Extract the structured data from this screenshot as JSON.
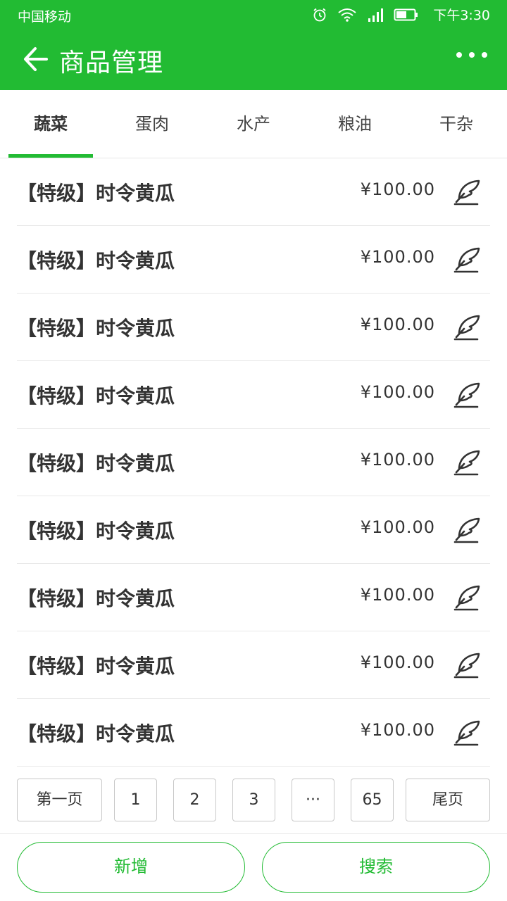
{
  "status_bar": {
    "carrier": "中国移动",
    "time": "下午3:30",
    "icons": [
      "alarm-icon",
      "wifi-icon",
      "signal-icon",
      "battery-icon"
    ]
  },
  "app_bar": {
    "title": "商品管理",
    "back_icon": "back-arrow-icon",
    "more_icon": "more-icon"
  },
  "tabs": [
    {
      "label": "蔬菜",
      "active": true
    },
    {
      "label": "蛋肉",
      "active": false
    },
    {
      "label": "水产",
      "active": false
    },
    {
      "label": "粮油",
      "active": false
    },
    {
      "label": "干杂",
      "active": false
    }
  ],
  "products": [
    {
      "name": "【特级】时令黄瓜",
      "price": "¥100.00"
    },
    {
      "name": "【特级】时令黄瓜",
      "price": "¥100.00"
    },
    {
      "name": "【特级】时令黄瓜",
      "price": "¥100.00"
    },
    {
      "name": "【特级】时令黄瓜",
      "price": "¥100.00"
    },
    {
      "name": "【特级】时令黄瓜",
      "price": "¥100.00"
    },
    {
      "name": "【特级】时令黄瓜",
      "price": "¥100.00"
    },
    {
      "name": "【特级】时令黄瓜",
      "price": "¥100.00"
    },
    {
      "name": "【特级】时令黄瓜",
      "price": "¥100.00"
    },
    {
      "name": "【特级】时令黄瓜",
      "price": "¥100.00"
    }
  ],
  "pagination": {
    "first": "第一页",
    "pages": [
      "1",
      "2",
      "3"
    ],
    "ellipsis": "···",
    "last_page_number": "65",
    "last": "尾页"
  },
  "actions": {
    "add": "新增",
    "search": "搜索"
  },
  "colors": {
    "brand": "#22bb33",
    "text": "#333333",
    "divider": "#e8e8e8"
  }
}
